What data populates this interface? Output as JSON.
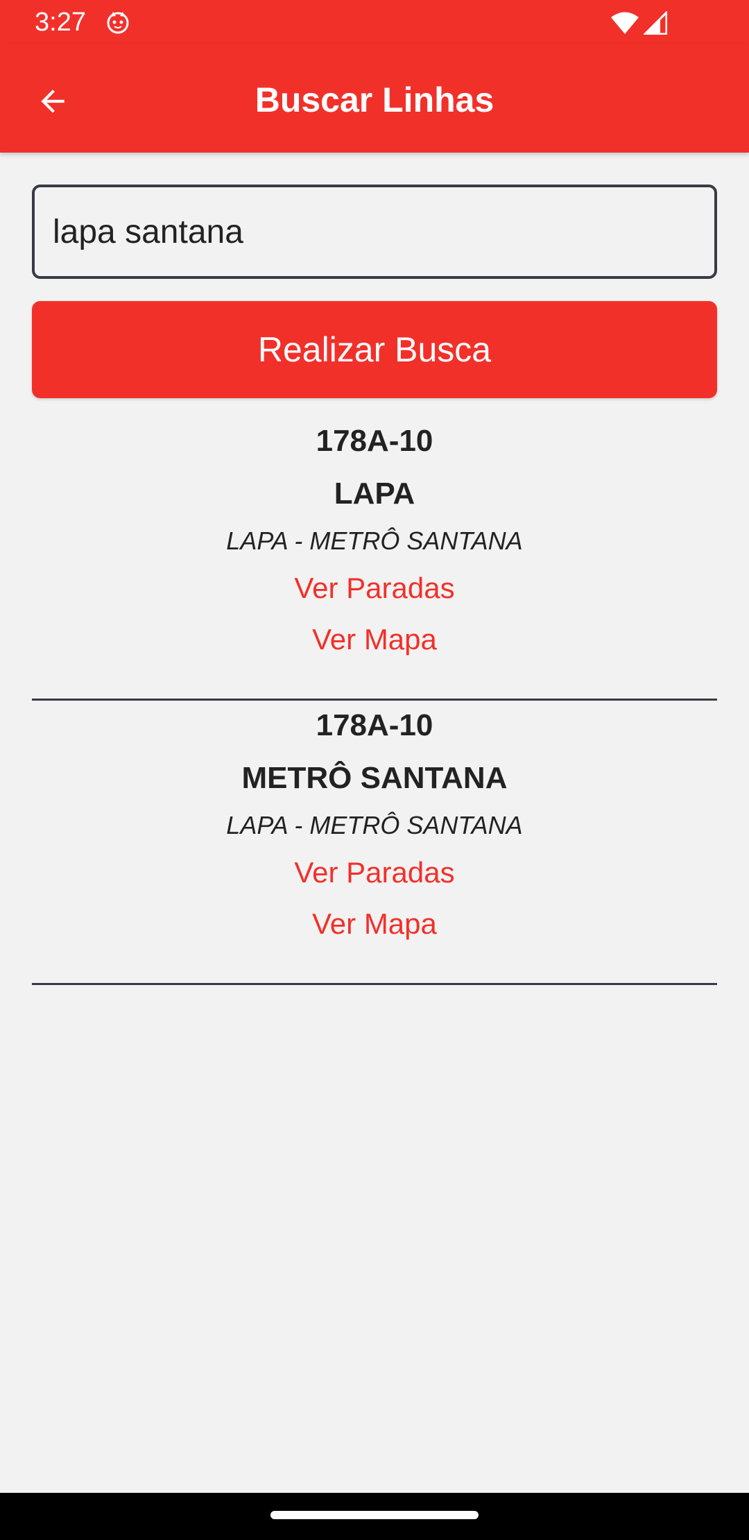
{
  "status_bar": {
    "time": "3:27",
    "icons": [
      "cat-notification-icon",
      "wifi-icon",
      "cell-signal-icon"
    ]
  },
  "app_bar": {
    "title": "Buscar Linhas",
    "back_icon": "arrow-back-icon"
  },
  "search": {
    "value": "lapa santana",
    "button_label": "Realizar Busca"
  },
  "results": [
    {
      "code": "178A-10",
      "destination": "LAPA",
      "route": "LAPA - METRÔ SANTANA",
      "stops_link": "Ver Paradas",
      "map_link": "Ver Mapa"
    },
    {
      "code": "178A-10",
      "destination": "METRÔ SANTANA",
      "route": "LAPA - METRÔ SANTANA",
      "stops_link": "Ver Paradas",
      "map_link": "Ver Mapa"
    }
  ],
  "colors": {
    "accent": "#f2302a",
    "background": "#f2f2f2",
    "text": "#222222",
    "divider": "#3a3a44"
  }
}
